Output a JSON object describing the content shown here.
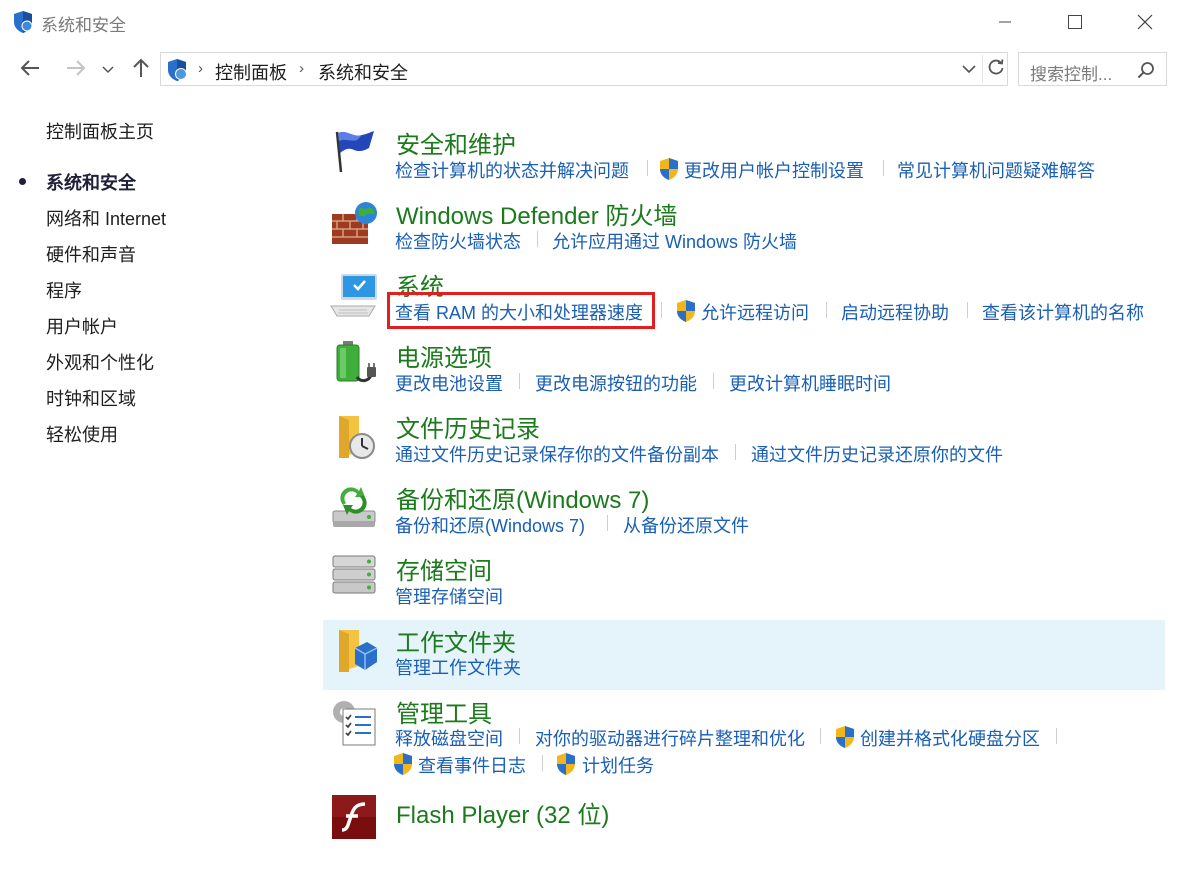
{
  "window": {
    "title": "系统和安全",
    "controls": {
      "minimize": "minimize",
      "maximize": "maximize",
      "close": "close"
    }
  },
  "navbar": {
    "breadcrumb": [
      "控制面板",
      "系统和安全"
    ],
    "search_placeholder": "搜索控制..."
  },
  "sidebar": {
    "home": "控制面板主页",
    "items": [
      {
        "label": "系统和安全",
        "current": true
      },
      {
        "label": "网络和 Internet"
      },
      {
        "label": "硬件和声音"
      },
      {
        "label": "程序"
      },
      {
        "label": "用户帐户"
      },
      {
        "label": "外观和个性化"
      },
      {
        "label": "时钟和区域"
      },
      {
        "label": "轻松使用"
      }
    ]
  },
  "categories": [
    {
      "title": "安全和维护",
      "icon": "flag-icon",
      "links": [
        "检查计算机的状态并解决问题",
        "更改用户帐户控制设置",
        "常见计算机问题疑难解答"
      ]
    },
    {
      "title": "Windows Defender 防火墙",
      "icon": "firewall-icon",
      "links": [
        "检查防火墙状态",
        "允许应用通过 Windows 防火墙"
      ]
    },
    {
      "title": "系统",
      "icon": "computer-icon",
      "links": [
        "查看 RAM 的大小和处理器速度",
        "允许远程访问",
        "启动远程协助",
        "查看该计算机的名称"
      ]
    },
    {
      "title": "电源选项",
      "icon": "battery-icon",
      "links": [
        "更改电池设置",
        "更改电源按钮的功能",
        "更改计算机睡眠时间"
      ]
    },
    {
      "title": "文件历史记录",
      "icon": "file-history-icon",
      "links": [
        "通过文件历史记录保存你的文件备份副本",
        "通过文件历史记录还原你的文件"
      ]
    },
    {
      "title": "备份和还原(Windows 7)",
      "icon": "backup-icon",
      "links": [
        "备份和还原(Windows 7)",
        "从备份还原文件"
      ]
    },
    {
      "title": "存储空间",
      "icon": "storage-icon",
      "links": [
        "管理存储空间"
      ]
    },
    {
      "title": "工作文件夹",
      "icon": "work-folders-icon",
      "links": [
        "管理工作文件夹"
      ]
    },
    {
      "title": "管理工具",
      "icon": "admin-tools-icon",
      "links": [
        "释放磁盘空间",
        "对你的驱动器进行碎片整理和优化",
        "创建并格式化硬盘分区",
        "查看事件日志",
        "计划任务"
      ]
    },
    {
      "title": "Flash Player (32 位)",
      "icon": "flash-icon",
      "links": []
    }
  ],
  "colors": {
    "link": "#1a5fb4",
    "category_title": "#1b7a1b",
    "highlight": "#e5f3fb",
    "annotation": "#e02020"
  }
}
